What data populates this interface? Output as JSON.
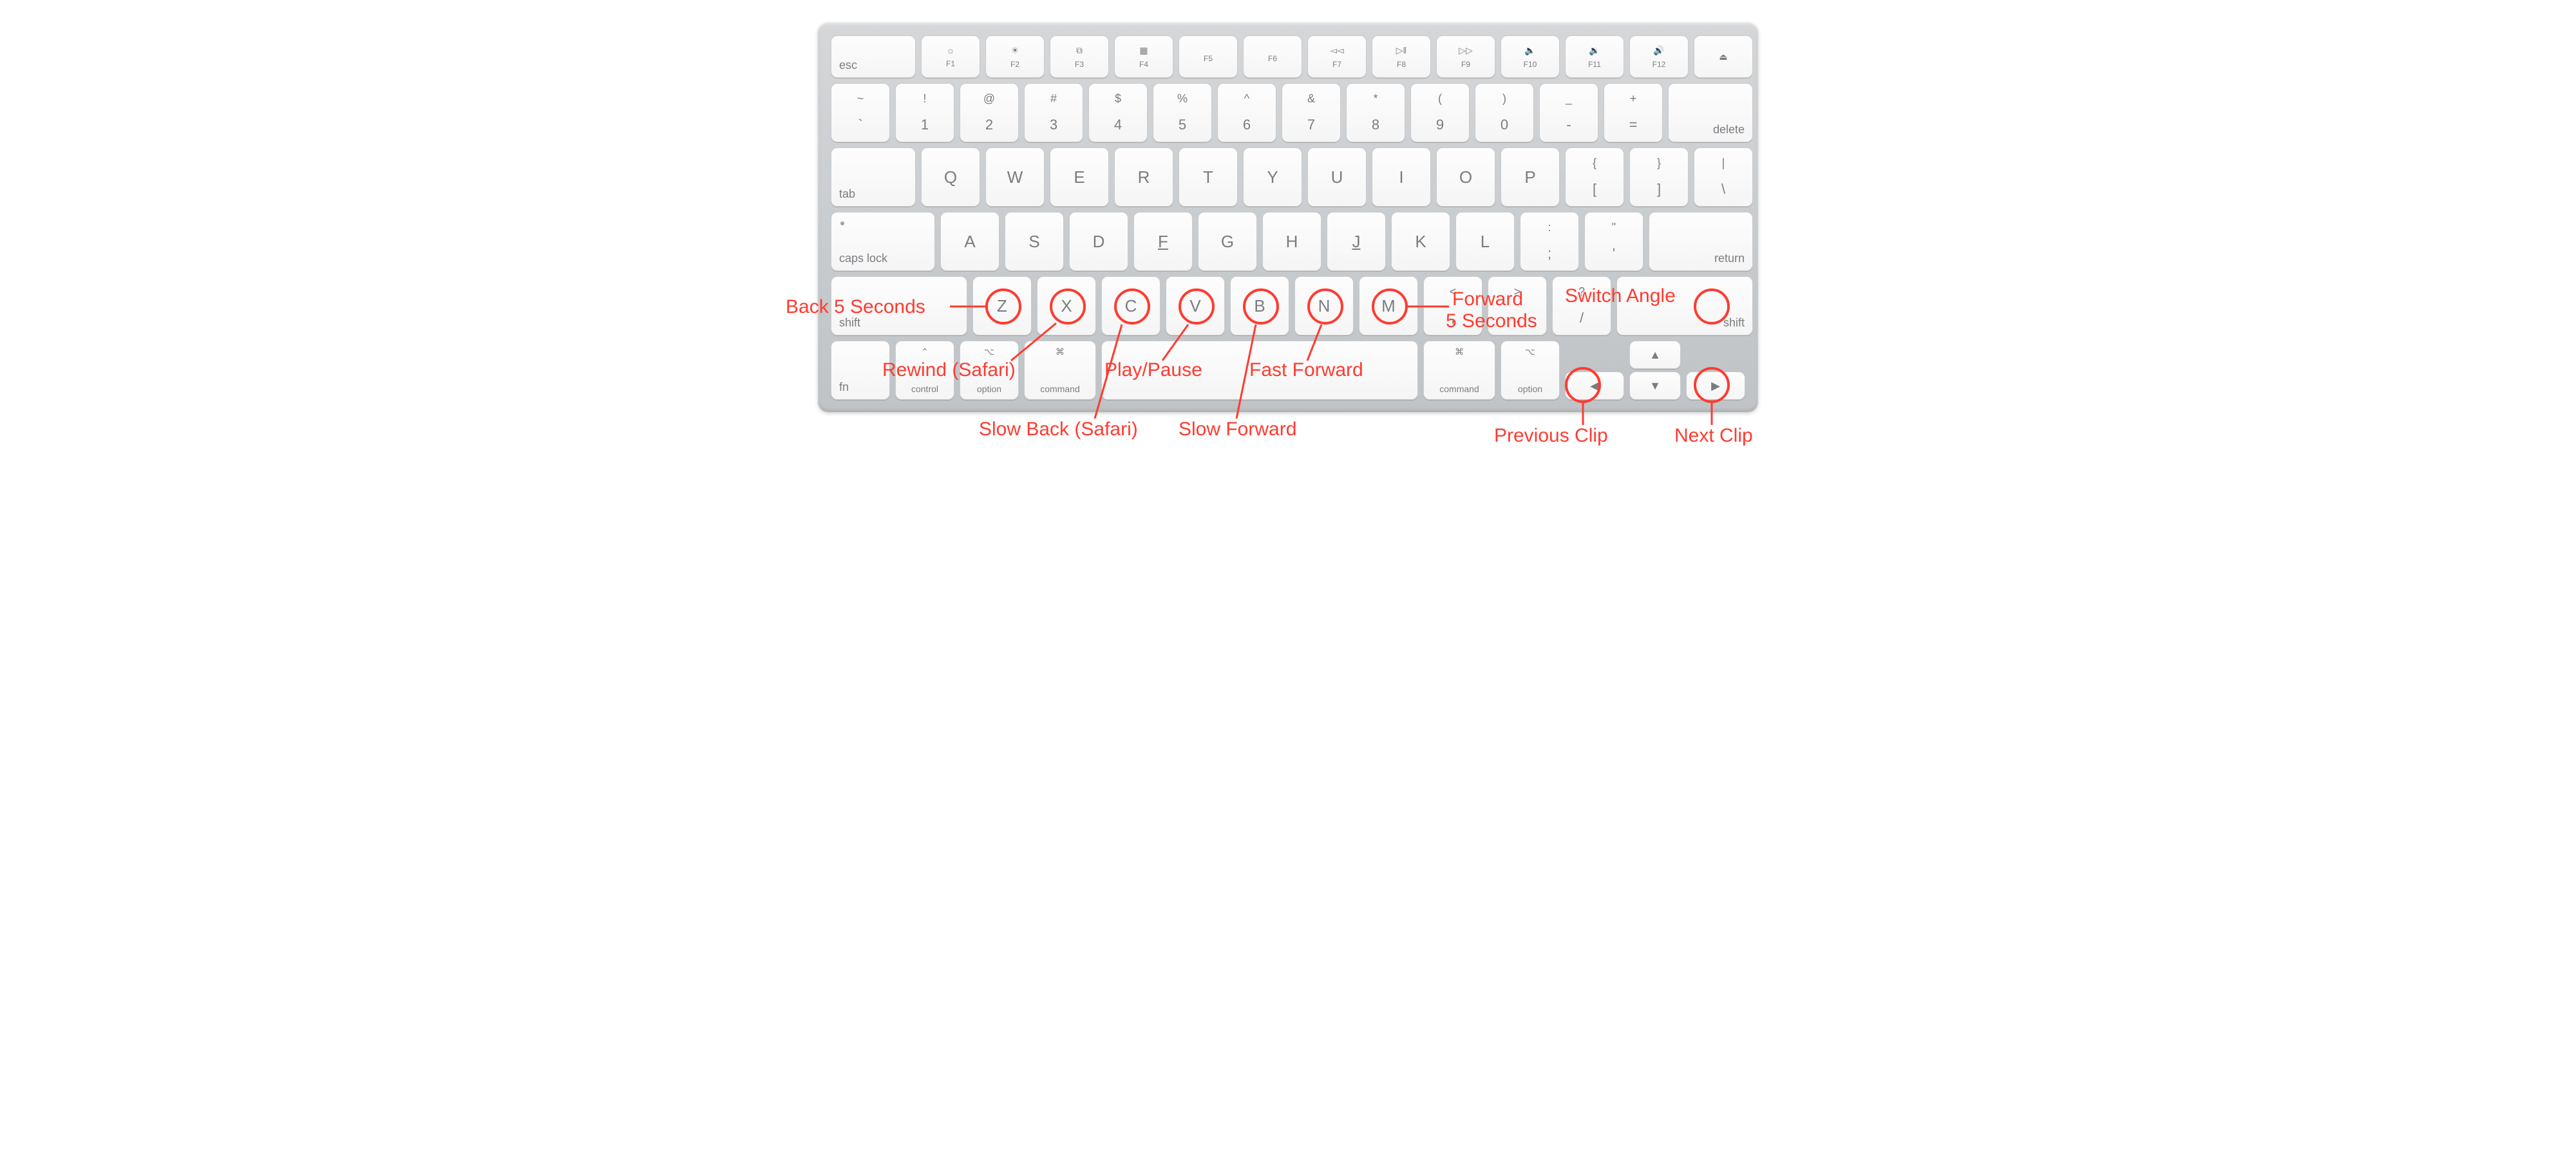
{
  "keyboard": {
    "fn_row": {
      "esc": "esc",
      "keys": [
        {
          "sym": "☼",
          "lab": "F1"
        },
        {
          "sym": "☀",
          "lab": "F2"
        },
        {
          "sym": "⧉",
          "lab": "F3"
        },
        {
          "sym": "▦",
          "lab": "F4"
        },
        {
          "sym": "",
          "lab": "F5"
        },
        {
          "sym": "",
          "lab": "F6"
        },
        {
          "sym": "◅◅",
          "lab": "F7"
        },
        {
          "sym": "▷‖",
          "lab": "F8"
        },
        {
          "sym": "▷▷",
          "lab": "F9"
        },
        {
          "sym": "🔈",
          "lab": "F10"
        },
        {
          "sym": "🔉",
          "lab": "F11"
        },
        {
          "sym": "🔊",
          "lab": "F12"
        }
      ],
      "eject": "⏏"
    },
    "num_row": {
      "keys": [
        {
          "t": "~",
          "b": "`"
        },
        {
          "t": "!",
          "b": "1"
        },
        {
          "t": "@",
          "b": "2"
        },
        {
          "t": "#",
          "b": "3"
        },
        {
          "t": "$",
          "b": "4"
        },
        {
          "t": "%",
          "b": "5"
        },
        {
          "t": "^",
          "b": "6"
        },
        {
          "t": "&",
          "b": "7"
        },
        {
          "t": "*",
          "b": "8"
        },
        {
          "t": "(",
          "b": "9"
        },
        {
          "t": ")",
          "b": "0"
        },
        {
          "t": "_",
          "b": "-"
        },
        {
          "t": "+",
          "b": "="
        }
      ],
      "delete": "delete"
    },
    "qwerty_row": {
      "tab": "tab",
      "keys": [
        "Q",
        "W",
        "E",
        "R",
        "T",
        "Y",
        "U",
        "I",
        "O",
        "P"
      ],
      "br1": {
        "t": "{",
        "b": "["
      },
      "br2": {
        "t": "}",
        "b": "]"
      },
      "bs": {
        "t": "|",
        "b": "\\"
      }
    },
    "home_row": {
      "caps": "caps lock",
      "keys": [
        "A",
        "S",
        "D",
        "F",
        "G",
        "H",
        "J",
        "K",
        "L"
      ],
      "sc": {
        "t": ":",
        "b": ";"
      },
      "qt": {
        "t": "\"",
        "b": "'"
      },
      "return": "return"
    },
    "shift_row": {
      "lshift": "shift",
      "keys": [
        "Z",
        "X",
        "C",
        "V",
        "B",
        "N",
        "M"
      ],
      "cm": {
        "t": "<",
        "b": ","
      },
      "pd": {
        "t": ">",
        "b": "."
      },
      "sl": {
        "t": "?",
        "b": "/"
      },
      "rshift": "shift"
    },
    "bottom_row": {
      "fn": "fn",
      "ctrl": "control",
      "lopt": "option",
      "lcmd": "command",
      "rcmd": "command",
      "ropt": "option",
      "cmd_sym": "⌘",
      "opt_sym": "⌥",
      "ctrl_sym": "⌃",
      "arrows": {
        "left": "◀",
        "up": "▲",
        "down": "▼",
        "right": "▶"
      }
    }
  },
  "annotations": {
    "back5": "Back 5 Seconds",
    "rewind": "Rewind (Safari)",
    "slowbk": "Slow Back (Safari)",
    "play": "Play/Pause",
    "slowfw": "Slow Forward",
    "fastfw": "Fast Forward",
    "fwd5a": "Forward",
    "fwd5b": "5 Seconds",
    "switch": "Switch Angle",
    "prev": "Previous Clip",
    "next": "Next Clip"
  }
}
